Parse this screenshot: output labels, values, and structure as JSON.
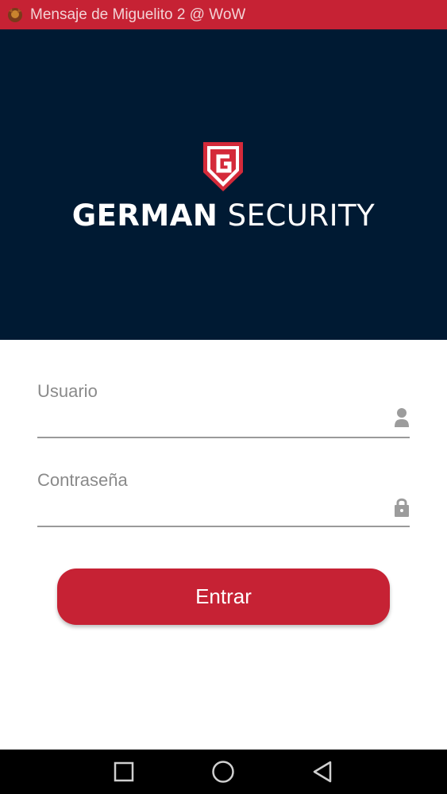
{
  "notification": {
    "icon": "game-avatar-icon",
    "text": "Mensaje de Miguelito 2 @ WoW"
  },
  "brand": {
    "logo": "shield-g-logo",
    "name_bold": "GERMAN",
    "name_light": "SECURITY"
  },
  "login_form": {
    "username_label": "Usuario",
    "username_value": "",
    "username_icon": "person-icon",
    "password_label": "Contraseña",
    "password_value": "",
    "password_icon": "lock-icon",
    "submit_label": "Entrar"
  },
  "navigation_bar": {
    "buttons": [
      "recents-square-icon",
      "home-circle-icon",
      "back-triangle-icon"
    ]
  },
  "colors": {
    "accent_red": "#c62234",
    "hero_navy": "#001a33",
    "label_gray": "#8a8a8a"
  }
}
